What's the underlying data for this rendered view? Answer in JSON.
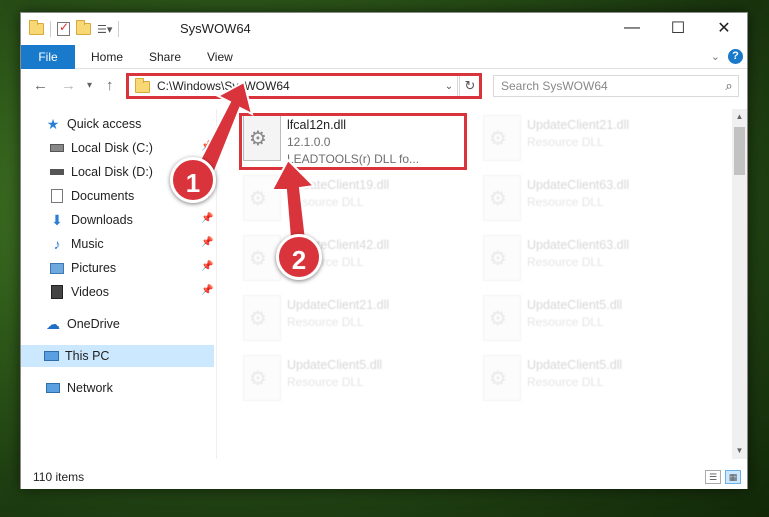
{
  "window": {
    "title": "SysWOW64"
  },
  "ribbon": {
    "tabs": [
      "File",
      "Home",
      "Share",
      "View"
    ]
  },
  "address": {
    "path": "C:\\Windows\\SysWOW64"
  },
  "search": {
    "placeholder": "Search SysWOW64"
  },
  "sidebar": {
    "items": [
      {
        "label": "Quick access",
        "icon": "star-icon"
      },
      {
        "label": "Local Disk (C:)",
        "icon": "drive-icon"
      },
      {
        "label": "Local Disk (D:)",
        "icon": "drive-icon"
      },
      {
        "label": "Documents",
        "icon": "documents-icon"
      },
      {
        "label": "Downloads",
        "icon": "downloads-icon"
      },
      {
        "label": "Music",
        "icon": "music-icon"
      },
      {
        "label": "Pictures",
        "icon": "pictures-icon"
      },
      {
        "label": "Videos",
        "icon": "videos-icon"
      },
      {
        "label": "OneDrive",
        "icon": "cloud-icon"
      },
      {
        "label": "This PC",
        "icon": "computer-icon"
      },
      {
        "label": "Network",
        "icon": "network-icon"
      }
    ]
  },
  "files": [
    {
      "name": "lfcal12n.dll",
      "line2": "12.1.0.0",
      "line3": "LEADTOOLS(r) DLL fo..."
    },
    {
      "name": "UpdateClient21.dll",
      "line2": "Resource DLL"
    },
    {
      "name": "UpdateClient19.dll",
      "line2": "Resource DLL"
    },
    {
      "name": "UpdateClient63.dll",
      "line2": "Resource DLL"
    },
    {
      "name": "UpdateClient42.dll",
      "line2": "Resource DLL"
    },
    {
      "name": "UpdateClient63.dll",
      "line2": "Resource DLL"
    },
    {
      "name": "UpdateClient21.dll",
      "line2": "Resource DLL"
    },
    {
      "name": "UpdateClient5.dll",
      "line2": "Resource DLL"
    },
    {
      "name": "UpdateClient5.dll",
      "line2": "Resource DLL"
    },
    {
      "name": "UpdateClient5.dll",
      "line2": "Resource DLL"
    }
  ],
  "status": {
    "items": "110 items"
  },
  "callouts": [
    "1",
    "2"
  ],
  "colors": {
    "accent": "#1979ca",
    "highlight": "#d9343b",
    "selection": "#cce8ff"
  }
}
